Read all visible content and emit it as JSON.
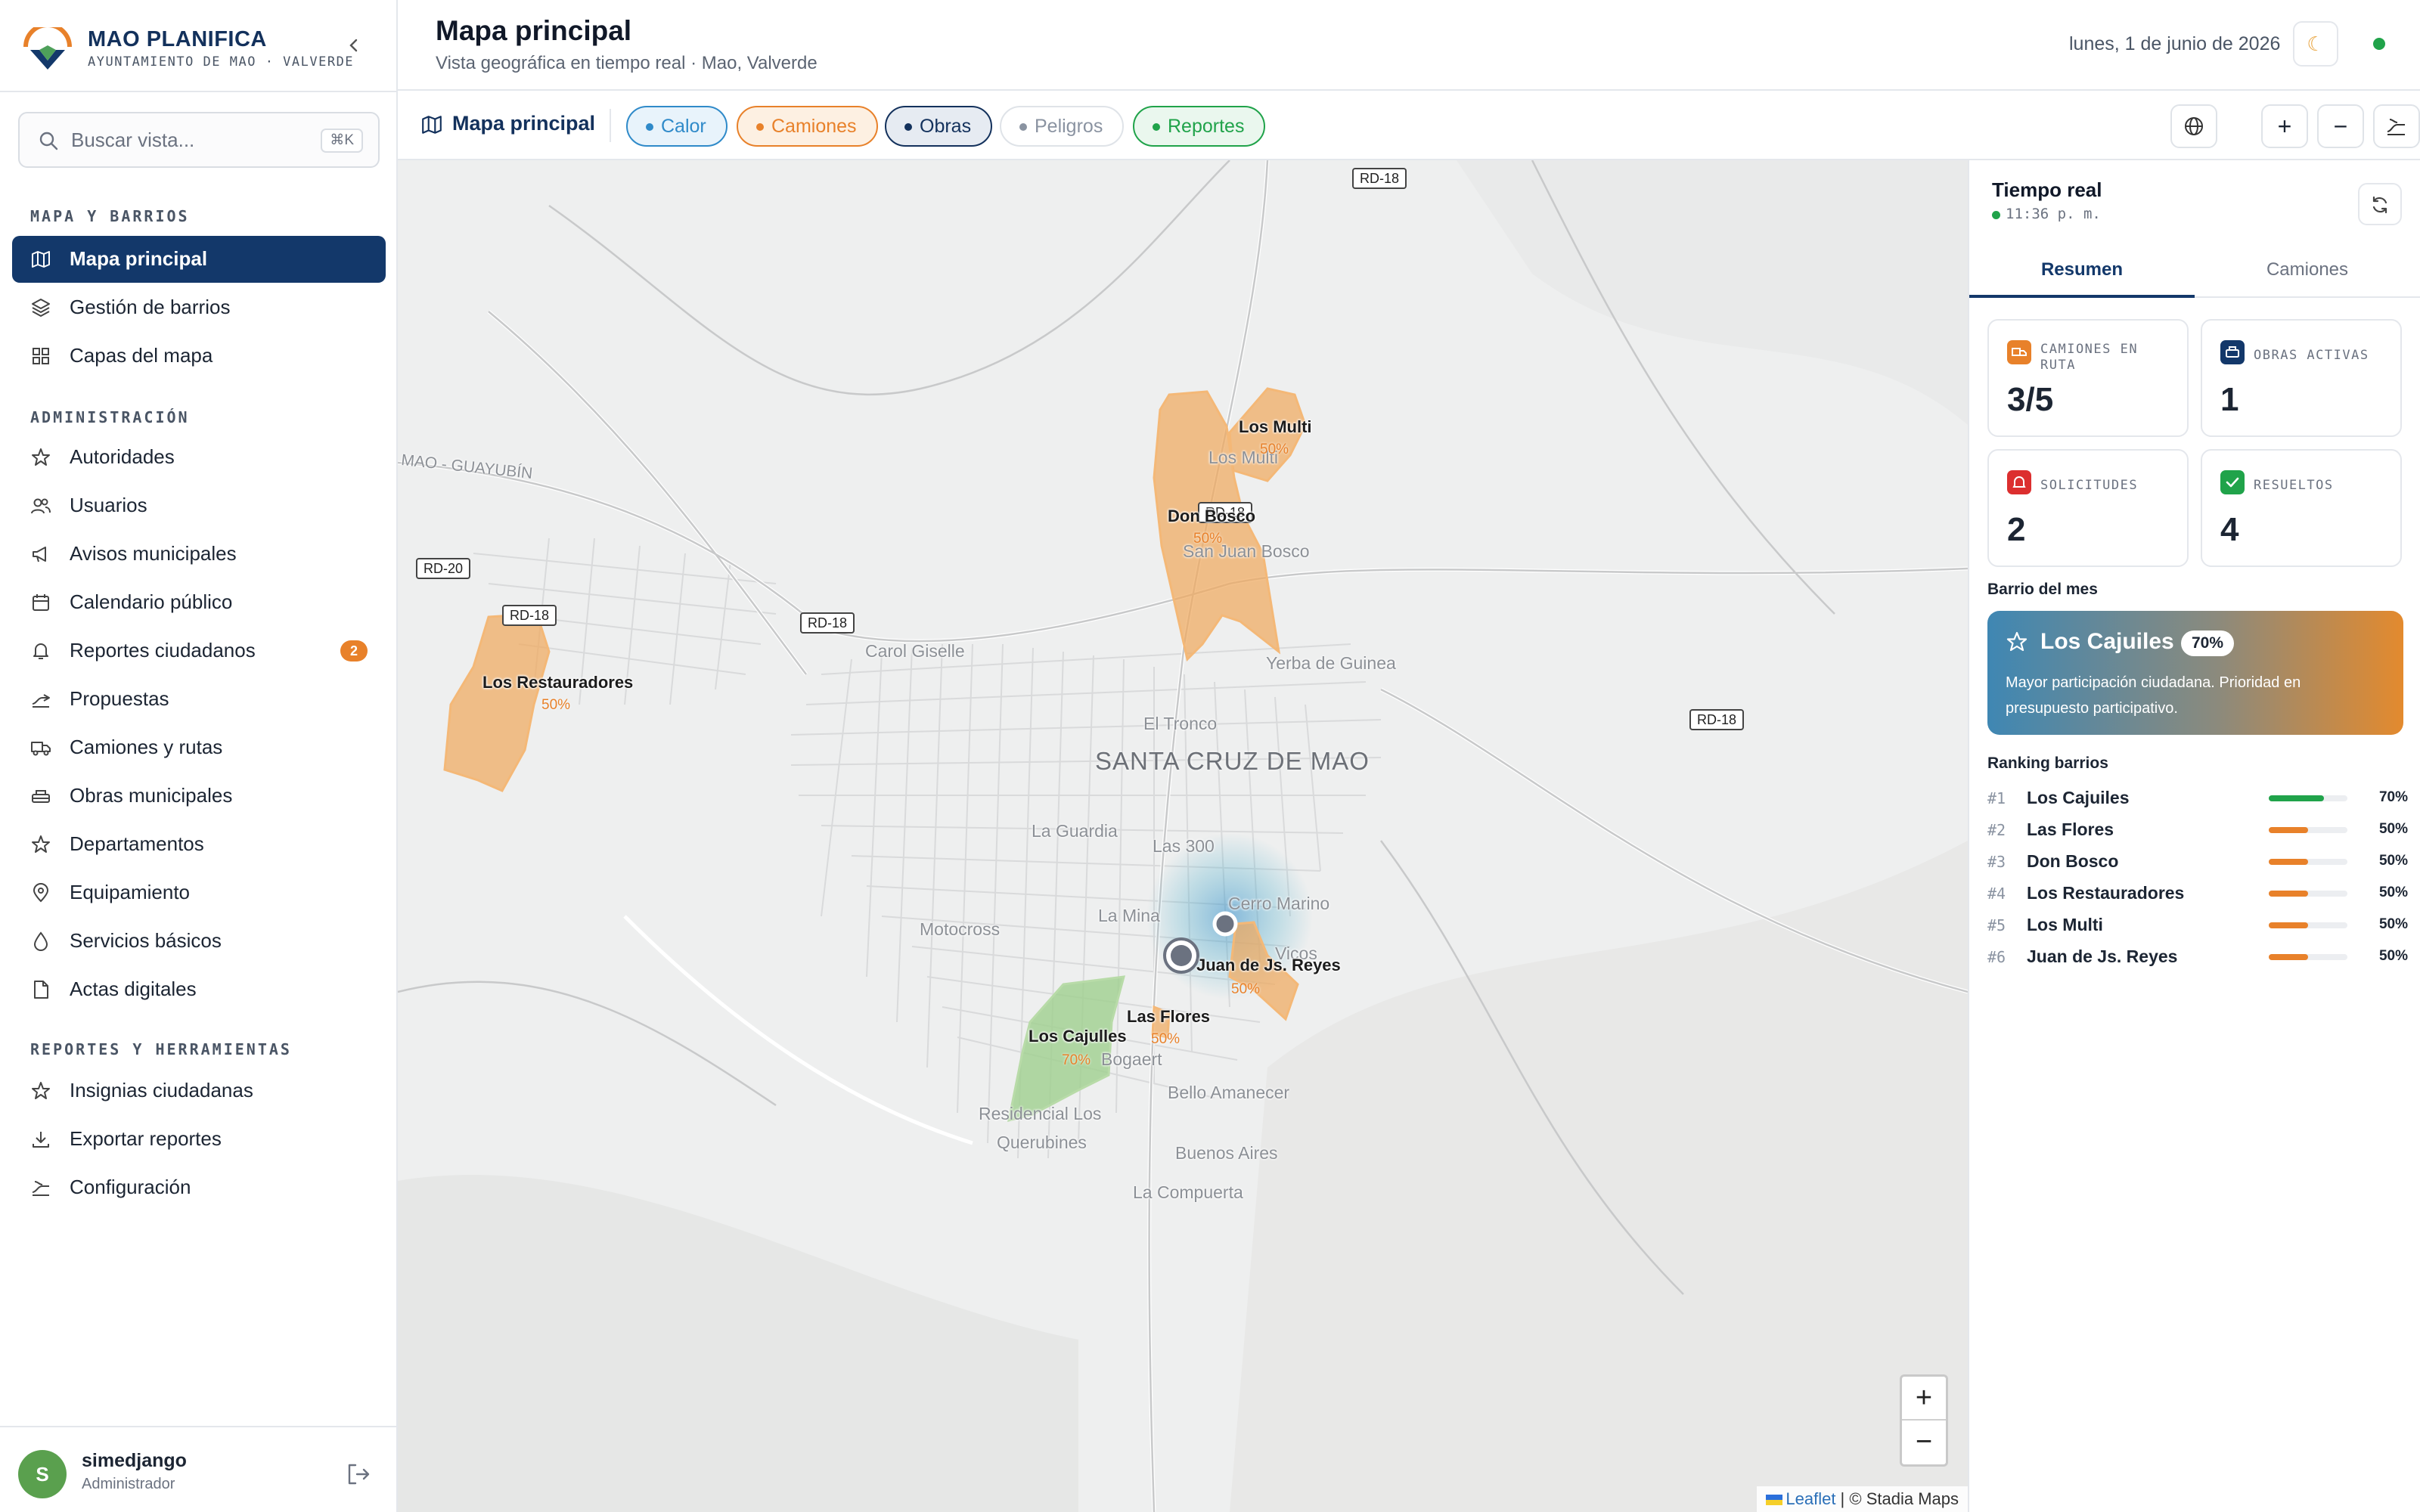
{
  "brand": {
    "title": "MAO PLANIFICA",
    "subtitle": "AYUNTAMIENTO DE MAO · VALVERDE"
  },
  "search": {
    "placeholder": "Buscar vista...",
    "shortcut": "⌘K"
  },
  "sidebar": {
    "sections": [
      {
        "title": "MAPA Y BARRIOS",
        "items": [
          {
            "label": "Mapa principal",
            "icon": "map-icon",
            "active": true
          },
          {
            "label": "Gestión de barrios",
            "icon": "layers-icon"
          },
          {
            "label": "Capas del mapa",
            "icon": "grid-icon"
          }
        ]
      },
      {
        "title": "ADMINISTRACIÓN",
        "items": [
          {
            "label": "Autoridades",
            "icon": "star-icon"
          },
          {
            "label": "Usuarios",
            "icon": "users-icon"
          },
          {
            "label": "Avisos municipales",
            "icon": "megaphone-icon"
          },
          {
            "label": "Calendario público",
            "icon": "calendar-icon"
          },
          {
            "label": "Reportes ciudadanos",
            "icon": "bell-icon",
            "badge": "2"
          },
          {
            "label": "Propuestas",
            "icon": "proposal-icon"
          },
          {
            "label": "Camiones y rutas",
            "icon": "truck-icon"
          },
          {
            "label": "Obras municipales",
            "icon": "construction-icon"
          },
          {
            "label": "Departamentos",
            "icon": "star-icon"
          },
          {
            "label": "Equipamiento",
            "icon": "pin-icon"
          },
          {
            "label": "Servicios básicos",
            "icon": "drop-icon"
          },
          {
            "label": "Actas digitales",
            "icon": "document-icon"
          }
        ]
      },
      {
        "title": "REPORTES Y HERRAMIENTAS",
        "items": [
          {
            "label": "Insignias ciudadanas",
            "icon": "star-icon"
          },
          {
            "label": "Exportar reportes",
            "icon": "download-icon"
          },
          {
            "label": "Configuración",
            "icon": "settings-icon"
          }
        ]
      }
    ]
  },
  "user": {
    "initial": "S",
    "name": "simedjango",
    "role": "Administrador"
  },
  "header": {
    "title": "Mapa principal",
    "subtitle": "Vista geográfica en tiempo real · Mao, Valverde",
    "date": "lunes, 1 de junio de 2026",
    "theme_icon": "moon-icon"
  },
  "toolbar": {
    "title": "Mapa principal",
    "layers": [
      {
        "label": "Calor",
        "color": "#2f8ac9",
        "bg": "#e8f3fb",
        "active": true
      },
      {
        "label": "Camiones",
        "color": "#e8812a",
        "bg": "#fdf0e2",
        "active": true
      },
      {
        "label": "Obras",
        "color": "#13315c",
        "bg": "#e6ebf2",
        "active": true
      },
      {
        "label": "Peligros",
        "color": "#8a93a1",
        "bg": "#ffffff",
        "active": false
      },
      {
        "label": "Reportes",
        "color": "#20a34a",
        "bg": "#eaf7ee",
        "active": true
      }
    ],
    "tools": [
      "globe-icon",
      "zoom-in-icon",
      "zoom-out-icon",
      "route-icon"
    ]
  },
  "map": {
    "city": "SANTA CRUZ DE MAO",
    "places": [
      "Carol Giselle",
      "Yerba de Guinea",
      "El Tronco",
      "La Guardia",
      "Las 300",
      "Motocross",
      "La Mina",
      "Cerro Marino",
      "Bello Amanecer",
      "Buenos Aires",
      "La Compuerta",
      "Residencial Los",
      "Querubines",
      "San Juan Bosco",
      "Los Multi",
      "Bogaert",
      "Vicos",
      "MAO - GUAYUBÍN"
    ],
    "roads": [
      "RD-18",
      "RD-18",
      "RD-18",
      "RD-18",
      "RD-20",
      "RD-18"
    ],
    "neighborhoods": [
      {
        "name": "Los Multi",
        "pct": "50%"
      },
      {
        "name": "Don Bosco",
        "pct": "50%"
      },
      {
        "name": "Los Restauradores",
        "pct": "50%"
      },
      {
        "name": "Juan de Js. Reyes",
        "pct": "50%"
      },
      {
        "name": "Las Flores",
        "pct": "50%"
      },
      {
        "name": "Los Cajulles",
        "pct": "70%"
      }
    ],
    "zoom_in": "+",
    "zoom_out": "−",
    "attribution_link": "Leaflet",
    "attribution_text": " | © Stadia Maps"
  },
  "panel": {
    "title": "Tiempo real",
    "time": "11:36 p. m.",
    "tabs": [
      "Resumen",
      "Camiones"
    ],
    "stats": [
      {
        "label": "CAMIONES EN RUTA",
        "value": "3/5",
        "color": "#e8812a",
        "icon": "truck-icon"
      },
      {
        "label": "OBRAS ACTIVAS",
        "value": "1",
        "color": "#13386a",
        "icon": "construction-icon"
      },
      {
        "label": "SOLICITUDES",
        "value": "2",
        "color": "#dc2f2f",
        "icon": "bell-icon"
      },
      {
        "label": "RESUELTOS",
        "value": "4",
        "color": "#20a34a",
        "icon": "check-icon"
      }
    ],
    "featured_label": "Barrio del mes",
    "featured": {
      "name": "Los Cajuiles",
      "pct": "70%",
      "description": "Mayor participación ciudadana. Prioridad en presupuesto participativo."
    },
    "ranking_label": "Ranking barrios",
    "ranking": [
      {
        "rank": "#1",
        "name": "Los Cajuiles",
        "pct": "70%",
        "value": 0.7,
        "color": "#20a34a"
      },
      {
        "rank": "#2",
        "name": "Las Flores",
        "pct": "50%",
        "value": 0.5,
        "color": "#e8812a"
      },
      {
        "rank": "#3",
        "name": "Don Bosco",
        "pct": "50%",
        "value": 0.5,
        "color": "#e8812a"
      },
      {
        "rank": "#4",
        "name": "Los Restauradores",
        "pct": "50%",
        "value": 0.5,
        "color": "#e8812a"
      },
      {
        "rank": "#5",
        "name": "Los Multi",
        "pct": "50%",
        "value": 0.5,
        "color": "#e8812a"
      },
      {
        "rank": "#6",
        "name": "Juan de Js. Reyes",
        "pct": "50%",
        "value": 0.5,
        "color": "#e8812a"
      }
    ]
  }
}
